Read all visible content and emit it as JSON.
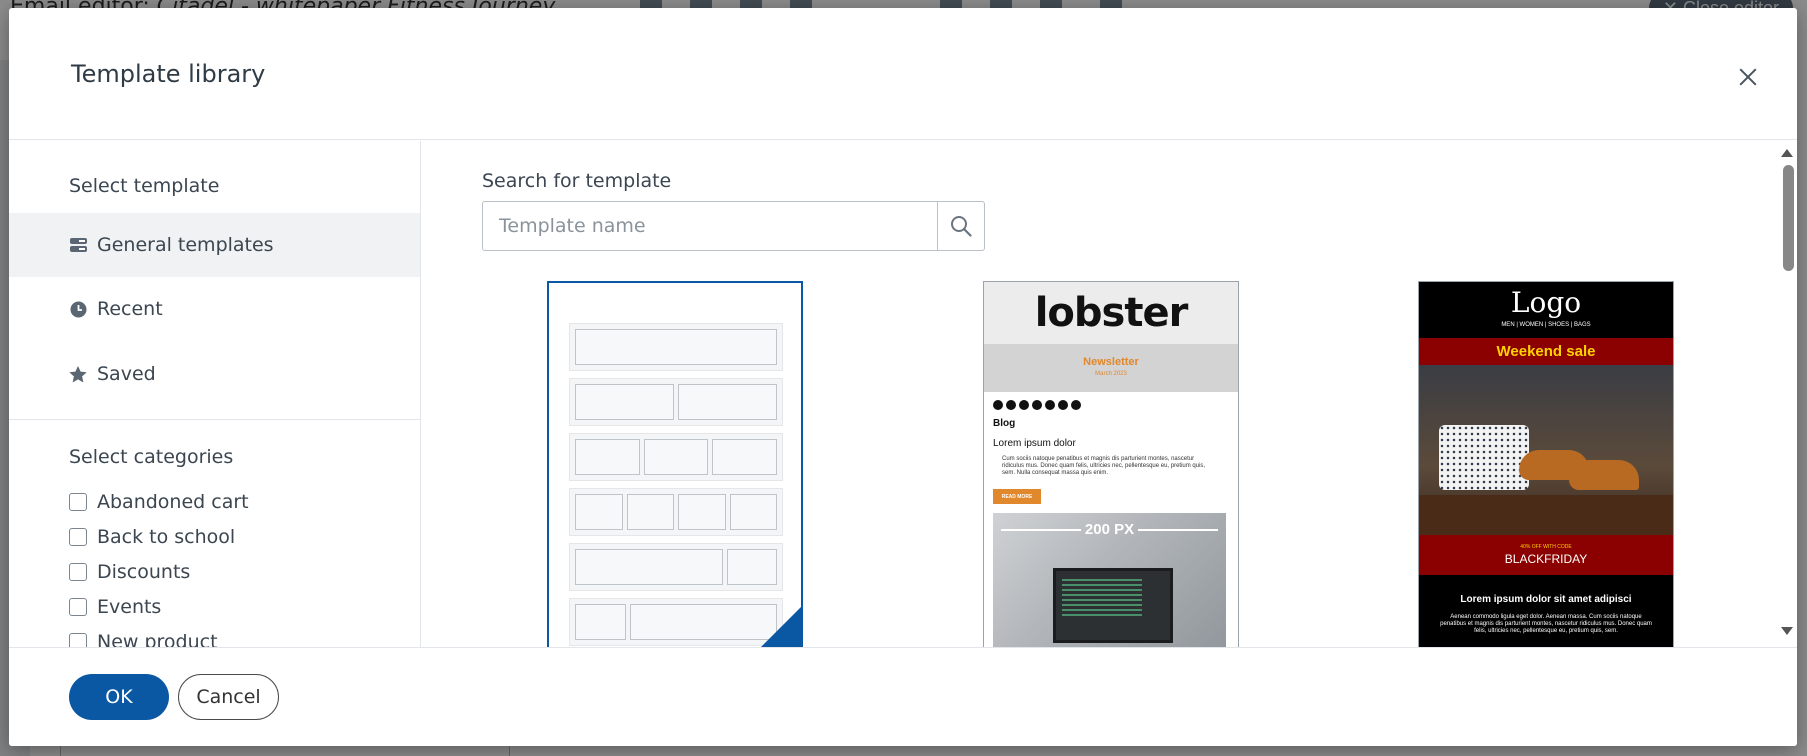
{
  "background": {
    "editor_title_prefix": "Email editor: ",
    "editor_title_name": "Citadel - whitepaper Fitness Journey",
    "close_editor_label": "✕ Close editor"
  },
  "modal": {
    "title": "Template library",
    "close_icon": "close-icon"
  },
  "sidebar": {
    "select_template_heading": "Select template",
    "items": [
      {
        "label": "General templates",
        "icon": "template-list-icon",
        "active": true
      },
      {
        "label": "Recent",
        "icon": "clock-icon",
        "active": false
      },
      {
        "label": "Saved",
        "icon": "star-icon",
        "active": false
      }
    ],
    "categories_heading": "Select categories",
    "categories": [
      {
        "label": "Abandoned cart",
        "checked": false
      },
      {
        "label": "Back to school",
        "checked": false
      },
      {
        "label": "Discounts",
        "checked": false
      },
      {
        "label": "Events",
        "checked": false
      },
      {
        "label": "New product",
        "checked": false
      }
    ]
  },
  "main": {
    "search_label": "Search for template",
    "search_placeholder": "Template name",
    "search_icon": "search-icon",
    "templates": [
      {
        "name": "blank-layout",
        "selected": true
      },
      {
        "name": "lobster-newsletter",
        "logo": "lobster",
        "newsletter": "Newsletter",
        "date": "March 2023",
        "blog": "Blog",
        "lorem": "Lorem ipsum dolor",
        "paragraph": "Cum sociis natoque penatibus et magnis dis parturient montes, nascetur ridiculus mus. Donec quam felis, ultricies nec, pellentesque eu, pretium quis, sem. Nulla consequat massa quis enim.",
        "button": "READ MORE",
        "image_label": "200 PX"
      },
      {
        "name": "weekend-sale",
        "logo": "Logo",
        "menu": "MEN  |  WOMEN  |  SHOES  |  BAGS",
        "sale": "Weekend sale",
        "offer": "40% OFF WITH CODE",
        "code": "BLACKFRIDAY",
        "heading": "Lorem ipsum dolor sit amet adipisci",
        "paragraph": "Aenean commodo ligula eget dolor. Aenean massa. Cum sociis natoque penatibus et magnis dis parturient montes, nascetur ridiculus mus. Donec quam felis, ultricies nec, pellentesque eu, pretium quis, sem."
      }
    ]
  },
  "footer": {
    "ok_label": "OK",
    "cancel_label": "Cancel"
  },
  "colors": {
    "primary": "#0a57a4",
    "sale_red": "#8b0000",
    "sale_yellow": "#ffd200",
    "lobster_orange": "#e1872c"
  }
}
